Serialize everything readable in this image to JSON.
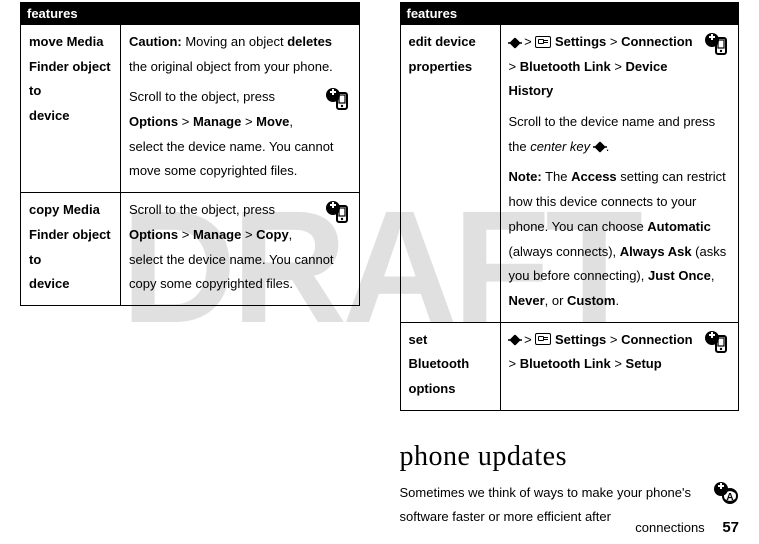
{
  "watermark": "DRAFT",
  "left": {
    "header": "features",
    "rows": [
      {
        "title_pre": "move ",
        "title_cond": "Media Finder",
        "title_post1": " object to",
        "title_post2": "device",
        "caution_label": "Caution:",
        "caution_text": " Moving an object ",
        "deletes": "deletes",
        "caution_tail": " the original object from your phone.",
        "p2a": "Scroll to the object, press ",
        "p2b": "Options",
        "gt1": " > ",
        "p2c": "Manage",
        "gt2": " > ",
        "p2d": "Move",
        "p2e": ", ",
        "p2f": "select the device name. You cannot move some copyrighted files."
      },
      {
        "title_pre": "copy ",
        "title_cond": "Media Finder",
        "title_post1": " object to",
        "title_post2": "device",
        "p1a": "Scroll to the object, press ",
        "p1b": "Options",
        "gt1": " > ",
        "p1c": "Manage",
        "gt2": " > ",
        "p1d": "Copy",
        "p1e": ", ",
        "p1f": "select the device name. You cannot copy some copyrighted files."
      }
    ]
  },
  "right": {
    "header": "features",
    "rows": [
      {
        "title1": "edit device",
        "title2": "properties",
        "path_gt": " > ",
        "path_settings": "Settings",
        "path_conn": "Connection",
        "path_bt": "Bluetooth Link",
        "path_hist": "Device History",
        "p2a": "Scroll to the device name and press the ",
        "p2b": "center key",
        "p2c": " ",
        "p2d": ".",
        "note_label": "Note:",
        "note_a": " The ",
        "note_access": "Access",
        "note_b": " setting can restrict how this device connects to your phone. You can choose ",
        "note_auto": "Automatic",
        "note_c": " (always connects), ",
        "note_ask": "Always Ask",
        "note_d": " (asks you before connecting), ",
        "note_once": "Just Once",
        "note_e": ", ",
        "note_never": "Never",
        "note_f": ", or ",
        "note_custom": "Custom",
        "note_g": "."
      },
      {
        "title1": "set Bluetooth",
        "title2": "options",
        "path_gt": " > ",
        "path_settings": "Settings",
        "path_conn": "Connection",
        "path_bt": "Bluetooth Link",
        "path_setup": "Setup"
      }
    ],
    "section_title": "phone updates",
    "section_body": "Sometimes we think of ways to make your phone's software faster or more efficient after"
  },
  "footer": {
    "label": "connections",
    "page": "57"
  }
}
